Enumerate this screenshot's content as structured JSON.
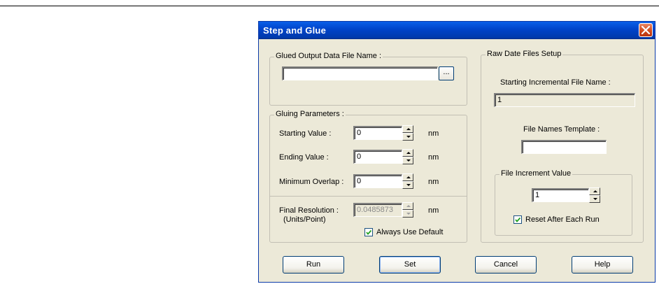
{
  "window": {
    "title": "Step and Glue"
  },
  "output_group": {
    "legend": "Glued Output Data File Name :",
    "file_value": "",
    "browse_label": "..."
  },
  "gluing": {
    "legend": "Gluing Parameters :",
    "starting_label": "Starting Value :",
    "starting_value": "0",
    "starting_unit": "nm",
    "ending_label": "Ending Value :",
    "ending_value": "0",
    "ending_unit": "nm",
    "overlap_label": "Minimum Overlap :",
    "overlap_value": "0",
    "overlap_unit": "nm",
    "resolution_label_1": "Final Resolution :",
    "resolution_label_2": "(Units/Point)",
    "resolution_value": "0.0485873",
    "resolution_unit": "nm",
    "always_default_label": "Always Use Default",
    "always_default_checked": true
  },
  "raw_setup": {
    "legend": "Raw Date Files Setup",
    "starting_file_label": "Starting Incremental File Name :",
    "starting_file_value": "1",
    "template_label": "File Names Template :",
    "template_value": "",
    "increment_legend": "File Increment Value",
    "increment_value": "1",
    "reset_label": "Reset After Each Run",
    "reset_checked": true
  },
  "buttons": {
    "run": "Run",
    "set": "Set",
    "cancel": "Cancel",
    "help": "Help"
  },
  "icons": {
    "close": "close-icon",
    "spin_up": "spin-up-icon",
    "spin_down": "spin-down-icon",
    "check": "checkmark-icon"
  },
  "colors": {
    "titlebar": "#0043c8",
    "dialog_bg": "#ece9d8",
    "close": "#d24a1c"
  }
}
